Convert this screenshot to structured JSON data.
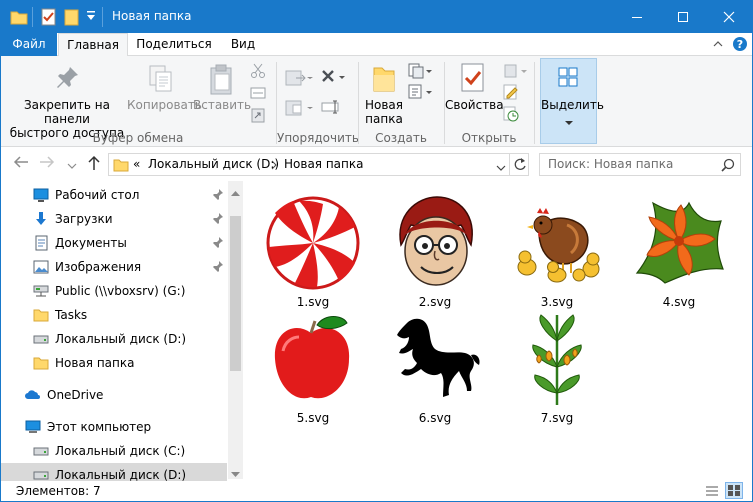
{
  "window": {
    "title": "Новая папка",
    "accent": "#1979ca"
  },
  "ribbon_tabs": [
    "Файл",
    "Главная",
    "Поделиться",
    "Вид"
  ],
  "ribbon": {
    "pin_label": "Закрепить на панели быстрого доступа",
    "pin_line1": "Закрепить на панели",
    "pin_line2": "быстрого доступа",
    "copy_label": "Копировать",
    "paste_label": "Вставить",
    "clipboard_group": "Буфер обмена",
    "organize_group": "Упорядочить",
    "new_folder_line1": "Новая",
    "new_folder_line2": "папка",
    "create_group": "Создать",
    "properties_label": "Свойства",
    "open_group": "Открыть",
    "select_label": "Выделить"
  },
  "address": {
    "overflow": "«",
    "crumb1": "Локальный диск (D:)",
    "crumb2": "Новая папка",
    "search_placeholder": "Поиск: Новая папка"
  },
  "nav_pane": {
    "items": [
      {
        "label": "Рабочий стол",
        "icon": "desktop-icon",
        "pinned": true
      },
      {
        "label": "Загрузки",
        "icon": "downloads-icon",
        "pinned": true
      },
      {
        "label": "Документы",
        "icon": "documents-icon",
        "pinned": true
      },
      {
        "label": "Изображения",
        "icon": "pictures-icon",
        "pinned": true
      },
      {
        "label": "Public (\\\\vboxsrv) (G:)",
        "icon": "network-drive-icon",
        "pinned": false
      },
      {
        "label": "Tasks",
        "icon": "folder-icon",
        "pinned": false
      },
      {
        "label": "Локальный диск (D:)",
        "icon": "drive-icon",
        "pinned": false
      },
      {
        "label": "Новая папка",
        "icon": "folder-icon",
        "pinned": false
      },
      {
        "label": "OneDrive",
        "icon": "onedrive-icon",
        "pinned": false
      },
      {
        "label": "Этот компьютер",
        "icon": "computer-icon",
        "pinned": false
      },
      {
        "label": "Локальный диск (C:)",
        "icon": "drive-icon",
        "pinned": false
      },
      {
        "label": "Локальный диск (D:)",
        "icon": "drive-icon",
        "pinned": false
      }
    ]
  },
  "files": [
    {
      "name": "1.svg",
      "thumb": "peppermint-candy"
    },
    {
      "name": "2.svg",
      "thumb": "cartoon-face"
    },
    {
      "name": "3.svg",
      "thumb": "hen-with-chicks"
    },
    {
      "name": "4.svg",
      "thumb": "orange-flower"
    },
    {
      "name": "5.svg",
      "thumb": "red-apple"
    },
    {
      "name": "6.svg",
      "thumb": "black-horse"
    },
    {
      "name": "7.svg",
      "thumb": "plant"
    }
  ],
  "status": {
    "item_count": "Элементов: 7"
  }
}
